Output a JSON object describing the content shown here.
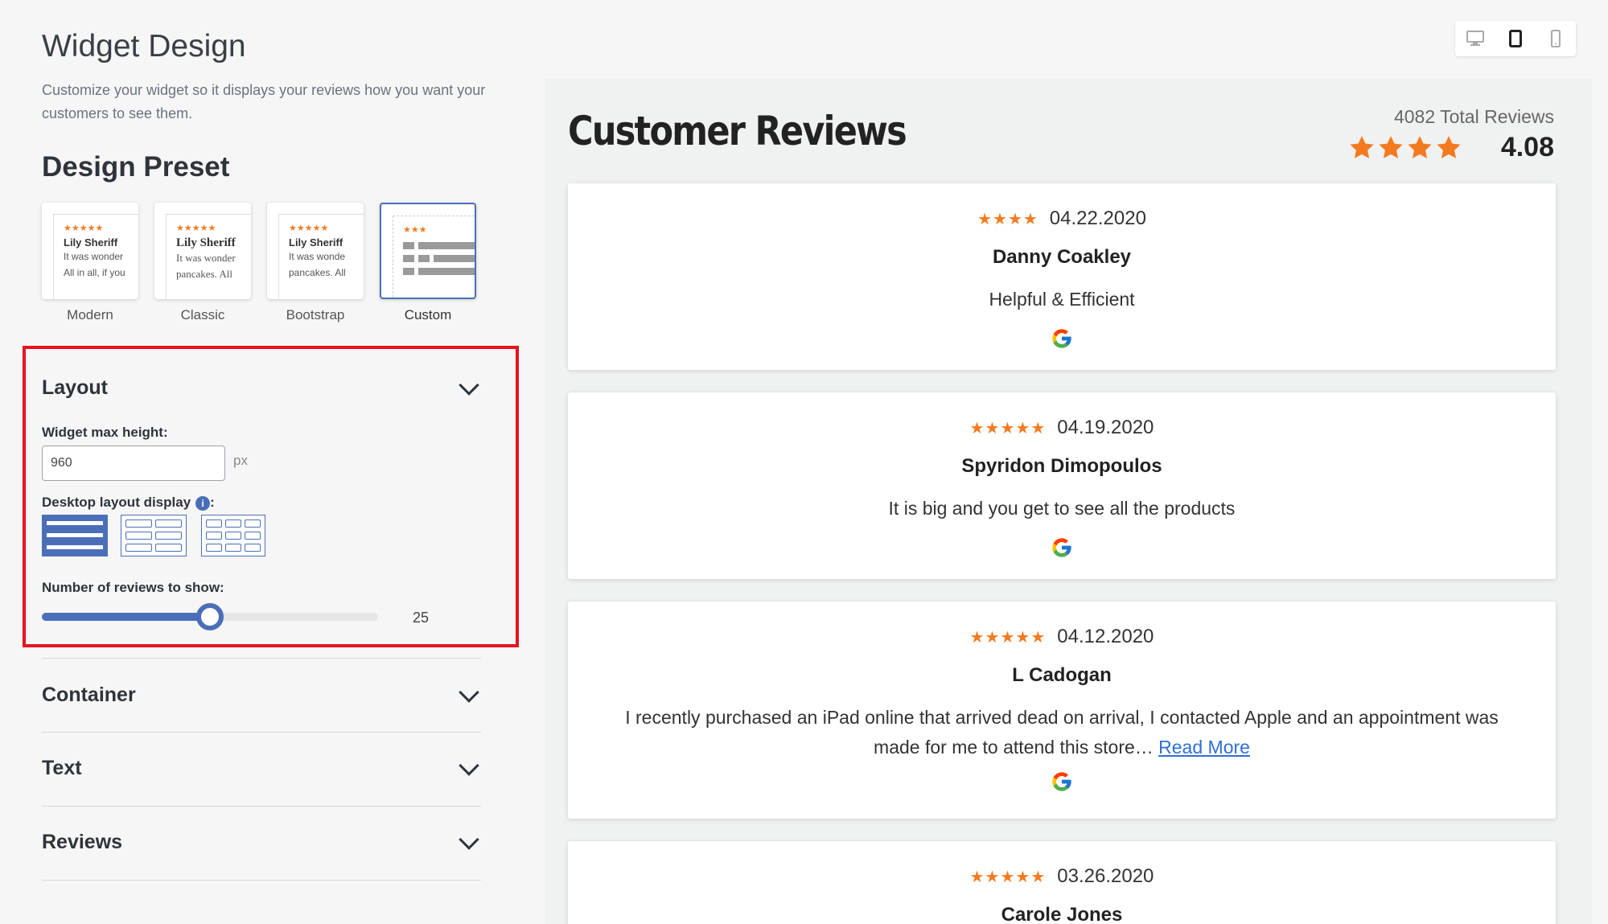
{
  "page": {
    "title": "Widget Design",
    "subtitle": "Customize your widget so it displays your reviews how you want your customers to see them."
  },
  "preset": {
    "heading": "Design Preset",
    "options": [
      {
        "label": "Modern",
        "name": "Lily Sheriff",
        "lines": [
          "It was wonder",
          "All in all, if you"
        ]
      },
      {
        "label": "Classic",
        "name": "Lily Sheriff",
        "lines": [
          "It was wonder",
          "pancakes. All"
        ]
      },
      {
        "label": "Bootstrap",
        "name": "Lily Sheriff",
        "lines": [
          "It was wonde",
          "pancakes. All"
        ]
      },
      {
        "label": "Custom"
      }
    ],
    "selected": "Custom"
  },
  "layout": {
    "heading": "Layout",
    "max_height_label": "Widget max height:",
    "max_height_value": "960",
    "unit": "px",
    "display_label": "Desktop layout display",
    "display_label_suffix": ":",
    "display_selected": "single-column",
    "reviews_count_label": "Number of reviews to show:",
    "reviews_count": "25",
    "reviews_count_fraction": 0.5
  },
  "sections": {
    "container": "Container",
    "text": "Text",
    "reviews": "Reviews"
  },
  "device_toggle": {
    "options": [
      "desktop-icon",
      "tablet-icon",
      "mobile-icon"
    ],
    "selected": "tablet-icon"
  },
  "preview": {
    "title": "Customer Reviews",
    "total_reviews": "4082 Total Reviews",
    "average": "4.08",
    "average_rating": 4.08,
    "star_color": "#f47a20",
    "reviews": [
      {
        "stars": "★★★★",
        "date": "04.22.2020",
        "name": "Danny Coakley",
        "text": "Helpful & Efficient",
        "source": "google-icon"
      },
      {
        "stars": "★★★★★",
        "date": "04.19.2020",
        "name": "Spyridon Dimopoulos",
        "text": "It is big and you get to see all the products",
        "source": "google-icon"
      },
      {
        "stars": "★★★★★",
        "date": "04.12.2020",
        "name": "L Cadogan",
        "text": "I recently purchased an iPad online that arrived dead on arrival, I contacted Apple and an appointment was made for me to attend this store…",
        "more": "Read More",
        "source": "google-icon"
      },
      {
        "stars": "★★★★★",
        "date": "03.26.2020",
        "name": "Carole Jones"
      }
    ]
  },
  "colors": {
    "accent": "#4a6fb8",
    "highlight_box": "#e8121e",
    "link": "#2f6fd6"
  }
}
